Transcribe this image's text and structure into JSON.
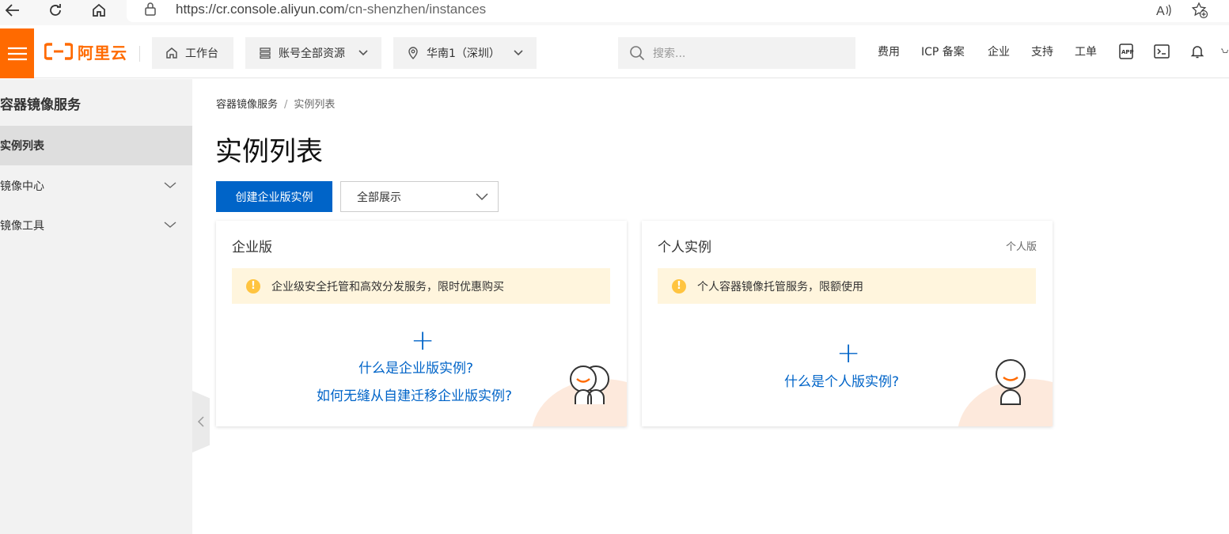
{
  "browser": {
    "url_host": "https://cr.console.aliyun.com",
    "url_path": "/cn-shenzhen/instances"
  },
  "header": {
    "logo_text": "阿里云",
    "workbench_label": "工作台",
    "resource_label": "账号全部资源",
    "region_label": "华南1（深圳）",
    "search_placeholder": "搜索...",
    "nav": {
      "cost": "费用",
      "icp": "ICP 备案",
      "enterprise": "企业",
      "support": "支持",
      "ticket": "工单"
    }
  },
  "sidebar": {
    "title": "容器镜像服务",
    "items": [
      {
        "label": "实例列表"
      },
      {
        "label": "镜像中心"
      },
      {
        "label": "镜像工具"
      }
    ]
  },
  "main": {
    "breadcrumb": {
      "root": "容器镜像服务",
      "separator": "/",
      "current": "实例列表"
    },
    "title": "实例列表",
    "create_button": "创建企业版实例",
    "filter_select": "全部展示",
    "cards": {
      "enterprise": {
        "title": "企业版",
        "notice": "企业级安全托管和高效分发服务，限时优惠购买",
        "link1": "什么是企业版实例?",
        "link2": "如何无缝从自建迁移企业版实例?"
      },
      "personal": {
        "title": "个人实例",
        "tag": "个人版",
        "notice": "个人容器镜像托管服务，限额使用",
        "link1": "什么是个人版实例?"
      }
    }
  },
  "colors": {
    "brand_orange": "#ff6a00",
    "primary_blue": "#0064c8",
    "notice_bg": "#fff5dd",
    "warn_yellow": "#ffc440"
  }
}
